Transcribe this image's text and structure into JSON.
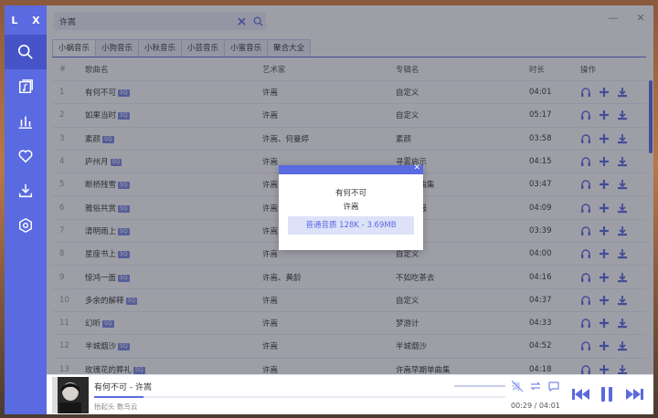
{
  "app": {
    "logo": "L X"
  },
  "search": {
    "value": "许嵩",
    "placeholder": ""
  },
  "tabs": [
    "小蜗音乐",
    "小狗音乐",
    "小秋音乐",
    "小芸音乐",
    "小蜜音乐",
    "聚合大全"
  ],
  "columns": {
    "idx": "#",
    "name": "歌曲名",
    "artist": "艺术家",
    "album": "专辑名",
    "duration": "时长",
    "ops": "操作"
  },
  "badge": "SQ",
  "rows": [
    {
      "idx": "1",
      "name": "有何不可",
      "sq": true,
      "artist": "许嵩",
      "album": "自定义",
      "duration": "04:01"
    },
    {
      "idx": "2",
      "name": "如果当时",
      "sq": true,
      "artist": "许嵩",
      "album": "自定义",
      "duration": "05:17"
    },
    {
      "idx": "3",
      "name": "素颜",
      "sq": true,
      "artist": "许嵩、何曼婷",
      "album": "素颜",
      "duration": "03:58"
    },
    {
      "idx": "4",
      "name": "庐州月",
      "sq": true,
      "artist": "许嵩",
      "album": "寻雾启示",
      "duration": "04:15"
    },
    {
      "idx": "5",
      "name": "断桥残雪",
      "sq": true,
      "artist": "许嵩",
      "album": "许嵩单曲集",
      "duration": "03:47"
    },
    {
      "idx": "6",
      "name": "雅俗共赏",
      "sq": true,
      "artist": "许嵩",
      "album": "青年晚报",
      "duration": "04:09"
    },
    {
      "idx": "7",
      "name": "清明雨上",
      "sq": true,
      "artist": "许嵩",
      "album": "自定义",
      "duration": "03:39"
    },
    {
      "idx": "8",
      "name": "星座书上",
      "sq": true,
      "artist": "许嵩",
      "album": "自定义",
      "duration": "04:00"
    },
    {
      "idx": "9",
      "name": "惊鸿一面",
      "sq": true,
      "artist": "许嵩、黄龄",
      "album": "不如吃茶去",
      "duration": "04:16"
    },
    {
      "idx": "10",
      "name": "多余的解释",
      "sq": true,
      "artist": "许嵩",
      "album": "自定义",
      "duration": "04:37"
    },
    {
      "idx": "11",
      "name": "幻听",
      "sq": true,
      "artist": "许嵩",
      "album": "梦游计",
      "duration": "04:33"
    },
    {
      "idx": "12",
      "name": "半城烟沙",
      "sq": true,
      "artist": "许嵩",
      "album": "半城烟沙",
      "duration": "04:52"
    },
    {
      "idx": "13",
      "name": "玫瑰花的葬礼",
      "sq": true,
      "artist": "许嵩",
      "album": "许嵩早期单曲集",
      "duration": "04:18"
    }
  ],
  "dialog": {
    "title": "有何不可",
    "artist": "许嵩",
    "quality": "普通音质 128K - 3.69MB"
  },
  "player": {
    "title": "有何不可 - 许嵩",
    "sub": "抬起头 数鸟云",
    "time": "00:29 / 04:01",
    "progress": 0.12
  },
  "colors": {
    "accent": "#5a6ae0",
    "sidebar": "#5a6ae0"
  }
}
